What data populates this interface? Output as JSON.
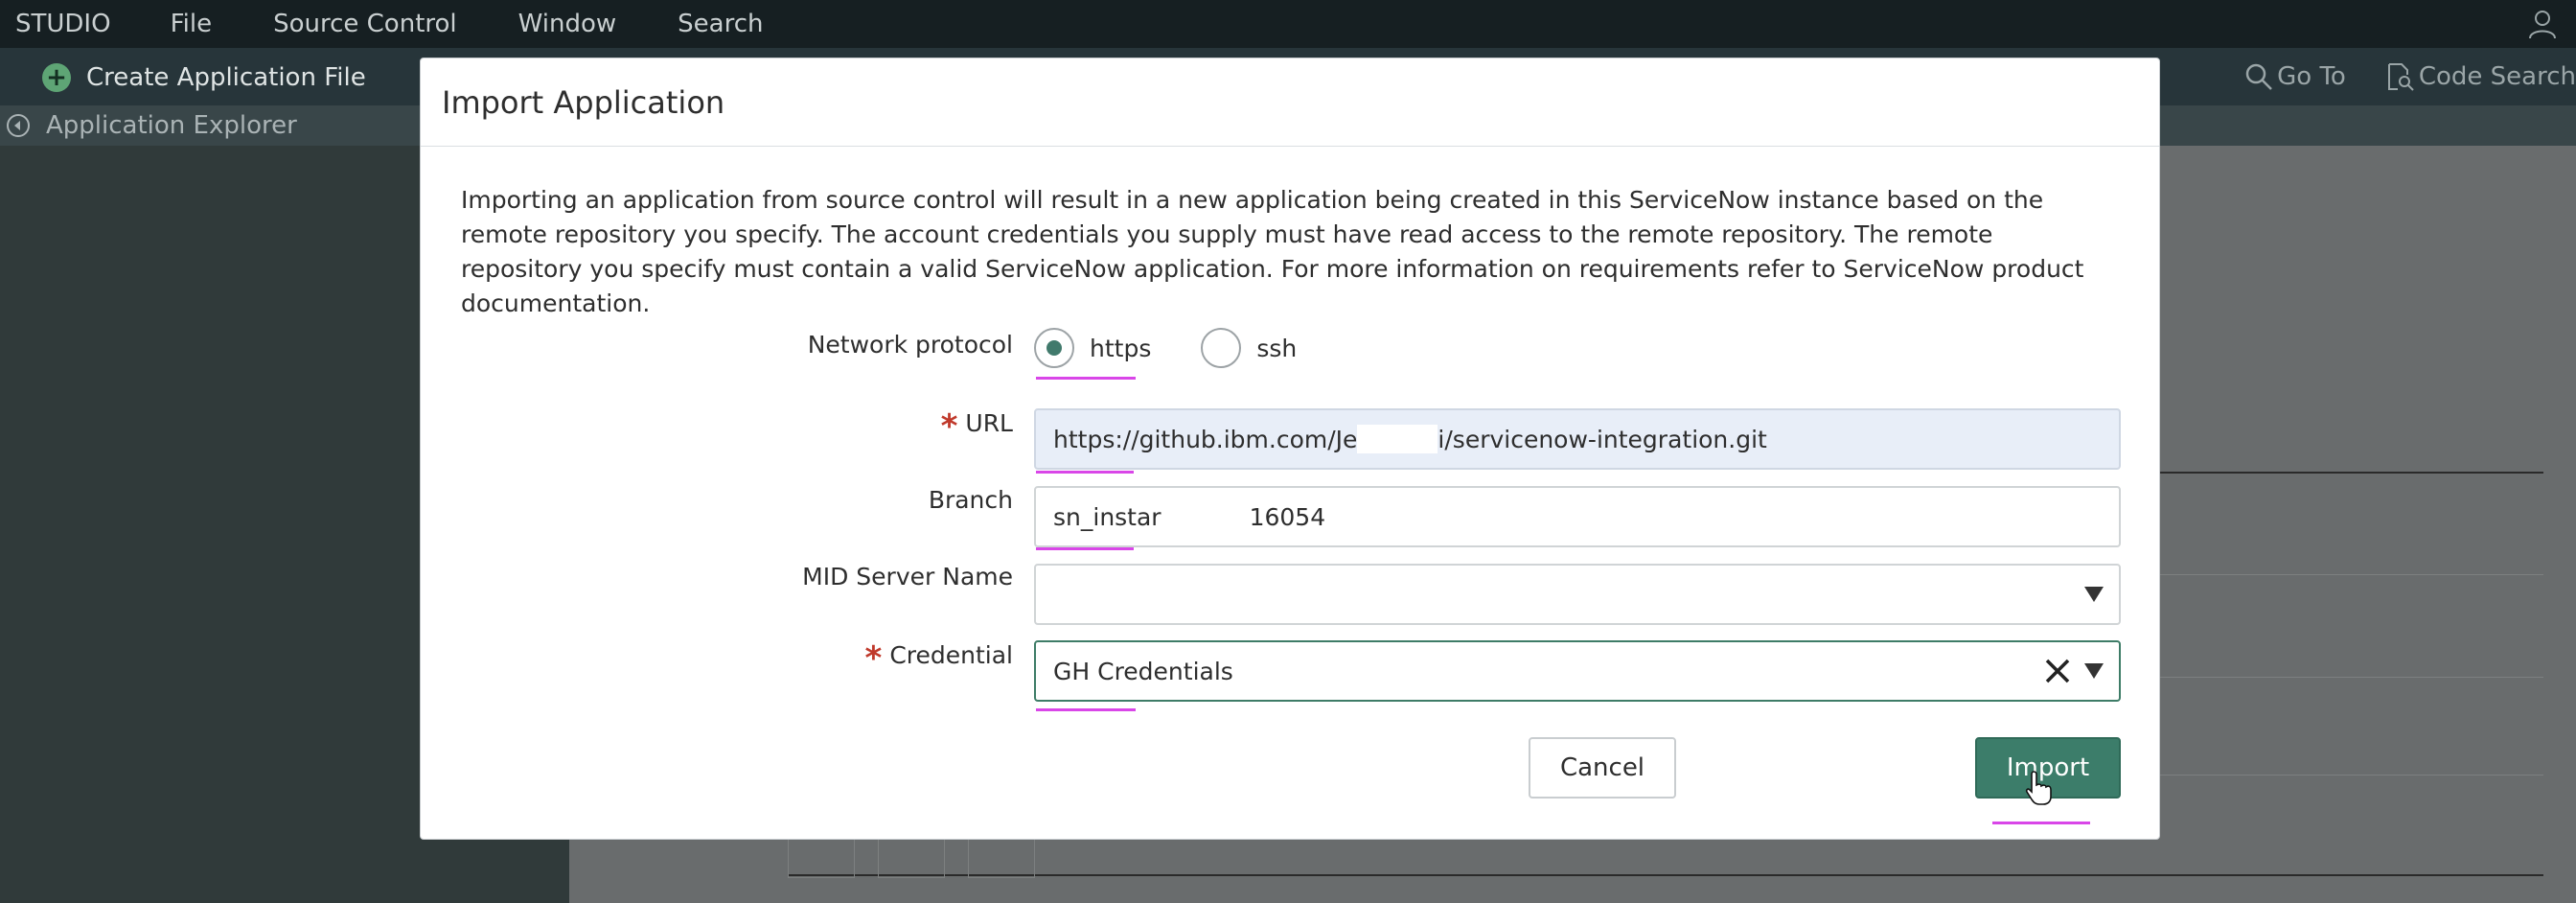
{
  "menubar": {
    "items": [
      "STUDIO",
      "File",
      "Source Control",
      "Window",
      "Search"
    ],
    "user_icon": "user-icon"
  },
  "toolbar": {
    "create_label": "Create Application File",
    "goto_label": "Go To",
    "code_search_label": "Code Search"
  },
  "explorer": {
    "label": "Application Explorer"
  },
  "modal": {
    "title": "Import Application",
    "description": "Importing an application from source control will result in a new application being created in this ServiceNow instance based on the remote repository you specify. The account credentials you supply must have read access to the remote repository. The remote repository you specify must contain a valid ServiceNow application. For more information on requirements refer to ServiceNow product documentation.",
    "network_protocol": {
      "label": "Network protocol",
      "options": [
        "https",
        "ssh"
      ],
      "selected": "https"
    },
    "url": {
      "label": "URL",
      "value_start": "https://github.ibm.com/Je",
      "value_end": "i/servicenow-integration.git",
      "required": true
    },
    "branch": {
      "label": "Branch",
      "value_start": "sn_instar",
      "value_end": "16054"
    },
    "mid_server": {
      "label": "MID Server Name",
      "value": ""
    },
    "credential": {
      "label": "Credential",
      "value": "GH Credentials",
      "required": true
    },
    "buttons": {
      "cancel": "Cancel",
      "import": "Import"
    }
  },
  "colors": {
    "accent": "#3c7d6a",
    "required": "#c0392b",
    "highlight": "#d946e8"
  }
}
